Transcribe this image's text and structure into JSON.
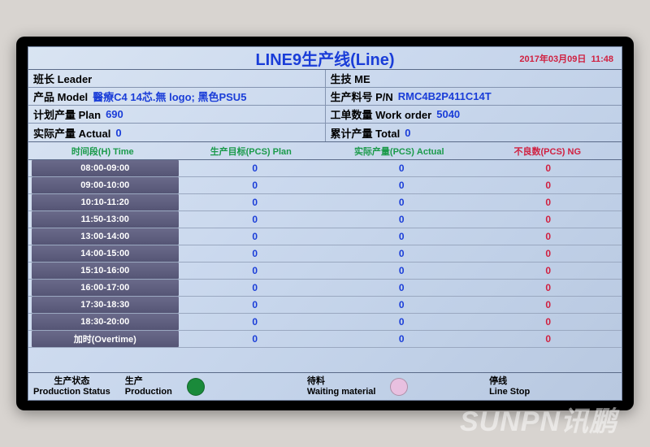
{
  "title": "LINE9生产线(Line)",
  "date": "2017年03月09日",
  "time": "11:48",
  "info": {
    "leader_label": "班长 Leader",
    "leader_value": "",
    "me_label": "生技 ME",
    "me_value": "",
    "model_label": "产品 Model",
    "model_value": "醫療C4 14芯.無 logo; 黑色PSU5",
    "pn_label": "生产料号 P/N",
    "pn_value": "RMC4B2P411C14T",
    "plan_label": "计划产量 Plan",
    "plan_value": "690",
    "wo_label": "工单数量 Work order",
    "wo_value": "5040",
    "actual_label": "实际产量 Actual",
    "actual_value": "0",
    "total_label": "累计产量 Total",
    "total_value": "0"
  },
  "columns": {
    "time": "时间段(H) Time",
    "plan": "生产目标(PCS) Plan",
    "actual": "实际产量(PCS) Actual",
    "ng": "不良数(PCS) NG"
  },
  "rows": [
    {
      "time": "08:00-09:00",
      "plan": "0",
      "actual": "0",
      "ng": "0"
    },
    {
      "time": "09:00-10:00",
      "plan": "0",
      "actual": "0",
      "ng": "0"
    },
    {
      "time": "10:10-11:20",
      "plan": "0",
      "actual": "0",
      "ng": "0"
    },
    {
      "time": "11:50-13:00",
      "plan": "0",
      "actual": "0",
      "ng": "0"
    },
    {
      "time": "13:00-14:00",
      "plan": "0",
      "actual": "0",
      "ng": "0"
    },
    {
      "time": "14:00-15:00",
      "plan": "0",
      "actual": "0",
      "ng": "0"
    },
    {
      "time": "15:10-16:00",
      "plan": "0",
      "actual": "0",
      "ng": "0"
    },
    {
      "time": "16:00-17:00",
      "plan": "0",
      "actual": "0",
      "ng": "0"
    },
    {
      "time": "17:30-18:30",
      "plan": "0",
      "actual": "0",
      "ng": "0"
    },
    {
      "time": "18:30-20:00",
      "plan": "0",
      "actual": "0",
      "ng": "0"
    },
    {
      "time": "加时(Overtime)",
      "plan": "0",
      "actual": "0",
      "ng": "0"
    }
  ],
  "status": {
    "title_cn": "生产状态",
    "title_en": "Production Status",
    "prod_cn": "生产",
    "prod_en": "Production",
    "prod_color": "#1a8a3a",
    "wait_cn": "待料",
    "wait_en": "Waiting material",
    "wait_color": "#e8c0e0",
    "stop_cn": "停线",
    "stop_en": "Line Stop",
    "stop_color": ""
  },
  "watermark": "SUNPN讯鹏"
}
